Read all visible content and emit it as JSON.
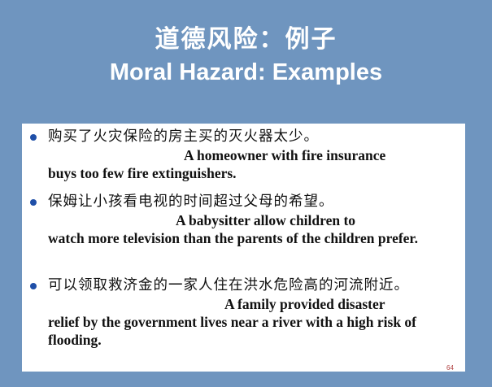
{
  "slide": {
    "title_zh": "道德风险：例子",
    "title_en": "Moral Hazard: Examples",
    "page_number": "64"
  },
  "bullets": [
    {
      "zh": "购买了火灾保险的房主买的灭火器太少。",
      "en_line1": "A homeowner with fire insurance",
      "en_rest": "buys too few fire extinguishers."
    },
    {
      "zh": "保姆让小孩看电视的时间超过父母的希望。",
      "en_line1": "A babysitter allow children to",
      "en_rest": "watch more television than the parents of the children prefer."
    },
    {
      "zh": "可以领取救济金的一家人住在洪水危险高的河流附近。",
      "en_line1": "A family provided disaster",
      "en_rest": "relief by the government lives near a river with a high risk of flooding."
    }
  ],
  "colors": {
    "background": "#6f95bf",
    "panel": "#ffffff",
    "bullet": "#1f4fa8",
    "title": "#ffffff"
  }
}
